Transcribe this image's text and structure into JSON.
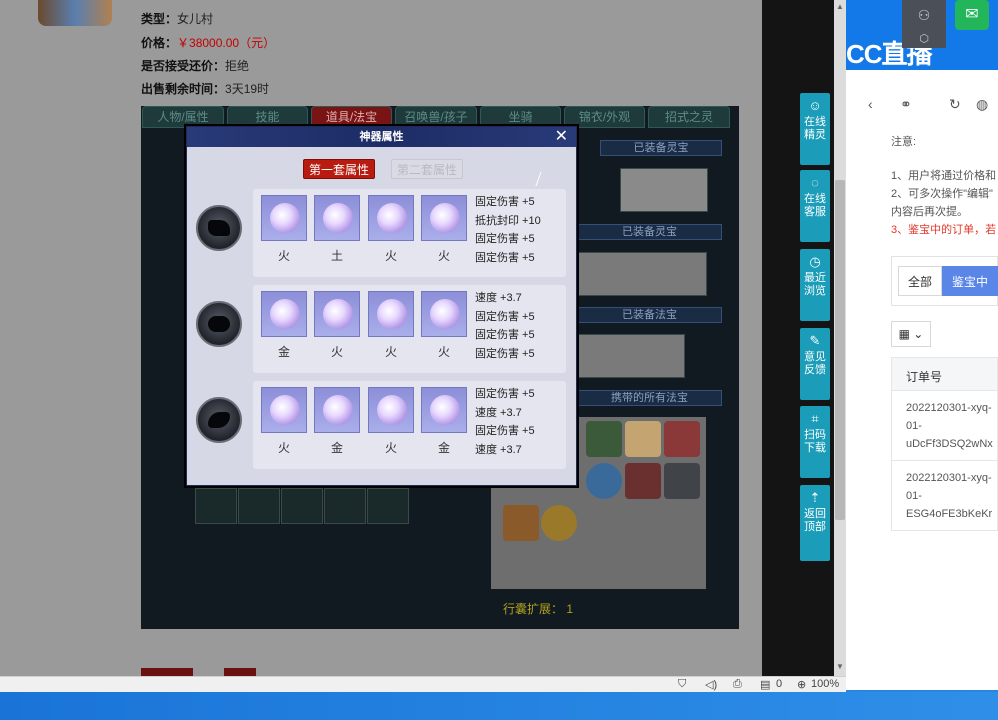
{
  "listing": {
    "type_label": "类型：",
    "type_value": "女儿村",
    "price_label": "价格：",
    "price_value": "￥38000.00（元）",
    "bargain_label": "是否接受还价：",
    "bargain_value": "拒绝",
    "remaining_label": "出售剩余时间：",
    "remaining_value": "3天19时"
  },
  "game_tabs": [
    "人物/属性",
    "技能",
    "道具/法宝",
    "召唤兽/孩子",
    "坐骑",
    "锦衣/外观",
    "招式之灵"
  ],
  "game_panels": {
    "equipped_spirit": "已装备灵宝",
    "spirit_gear": "已装备灵宝",
    "equipped_treasure": "已装备法宝",
    "all_treasure": "携带的所有法宝",
    "bag_ext_label": "行囊扩展：",
    "bag_ext_value": "1"
  },
  "modal": {
    "title": "神器属性",
    "set1": "第一套属性",
    "set2": "第二套属性",
    "rows": [
      {
        "elements": [
          "火",
          "土",
          "火",
          "火"
        ],
        "stats": [
          "固定伤害 +5",
          "抵抗封印 +10",
          "固定伤害 +5",
          "固定伤害 +5"
        ]
      },
      {
        "elements": [
          "金",
          "火",
          "火",
          "火"
        ],
        "stats": [
          "速度 +3.7",
          "固定伤害 +5",
          "固定伤害 +5",
          "固定伤害 +5"
        ]
      },
      {
        "elements": [
          "火",
          "金",
          "火",
          "金"
        ],
        "stats": [
          "固定伤害 +5",
          "速度 +3.7",
          "固定伤害 +5",
          "速度 +3.7"
        ]
      }
    ]
  },
  "sidebar": [
    {
      "icon": "headset-icon",
      "label": "在线精灵"
    },
    {
      "icon": "headphones-icon",
      "label": "在线客服"
    },
    {
      "icon": "clock-icon",
      "label": "最近浏览"
    },
    {
      "icon": "edit-icon",
      "label": "意见反馈"
    },
    {
      "icon": "scan-icon",
      "label": "扫码下载"
    },
    {
      "icon": "arrow-up-icon",
      "label": "返回顶部"
    }
  ],
  "statusbar": {
    "zero": "0",
    "zoom": "100%"
  },
  "right_panel": {
    "logo": "CC直播",
    "notice_title": "注意:",
    "notice_1": "1、用户将通过价格和",
    "notice_2": "2、可多次操作\"编辑\"",
    "notice_3": "内容后再次提。",
    "notice_4": "3、鉴宝中的订单，若",
    "tab_all": "全部",
    "tab_active": "鉴宝中",
    "grid_btn": "▦ ⌄",
    "order_header": "订单号",
    "orders": [
      [
        "2022120301-xyq-",
        "01-",
        "uDcFf3DSQ2wNx"
      ],
      [
        "2022120301-xyq-",
        "01-",
        "ESG4oFE3bKeKr"
      ]
    ]
  },
  "colors": {
    "accent": "#1b9cb8",
    "modal_title": "#283a78",
    "set_active": "#b81c10",
    "price": "#c30000"
  }
}
